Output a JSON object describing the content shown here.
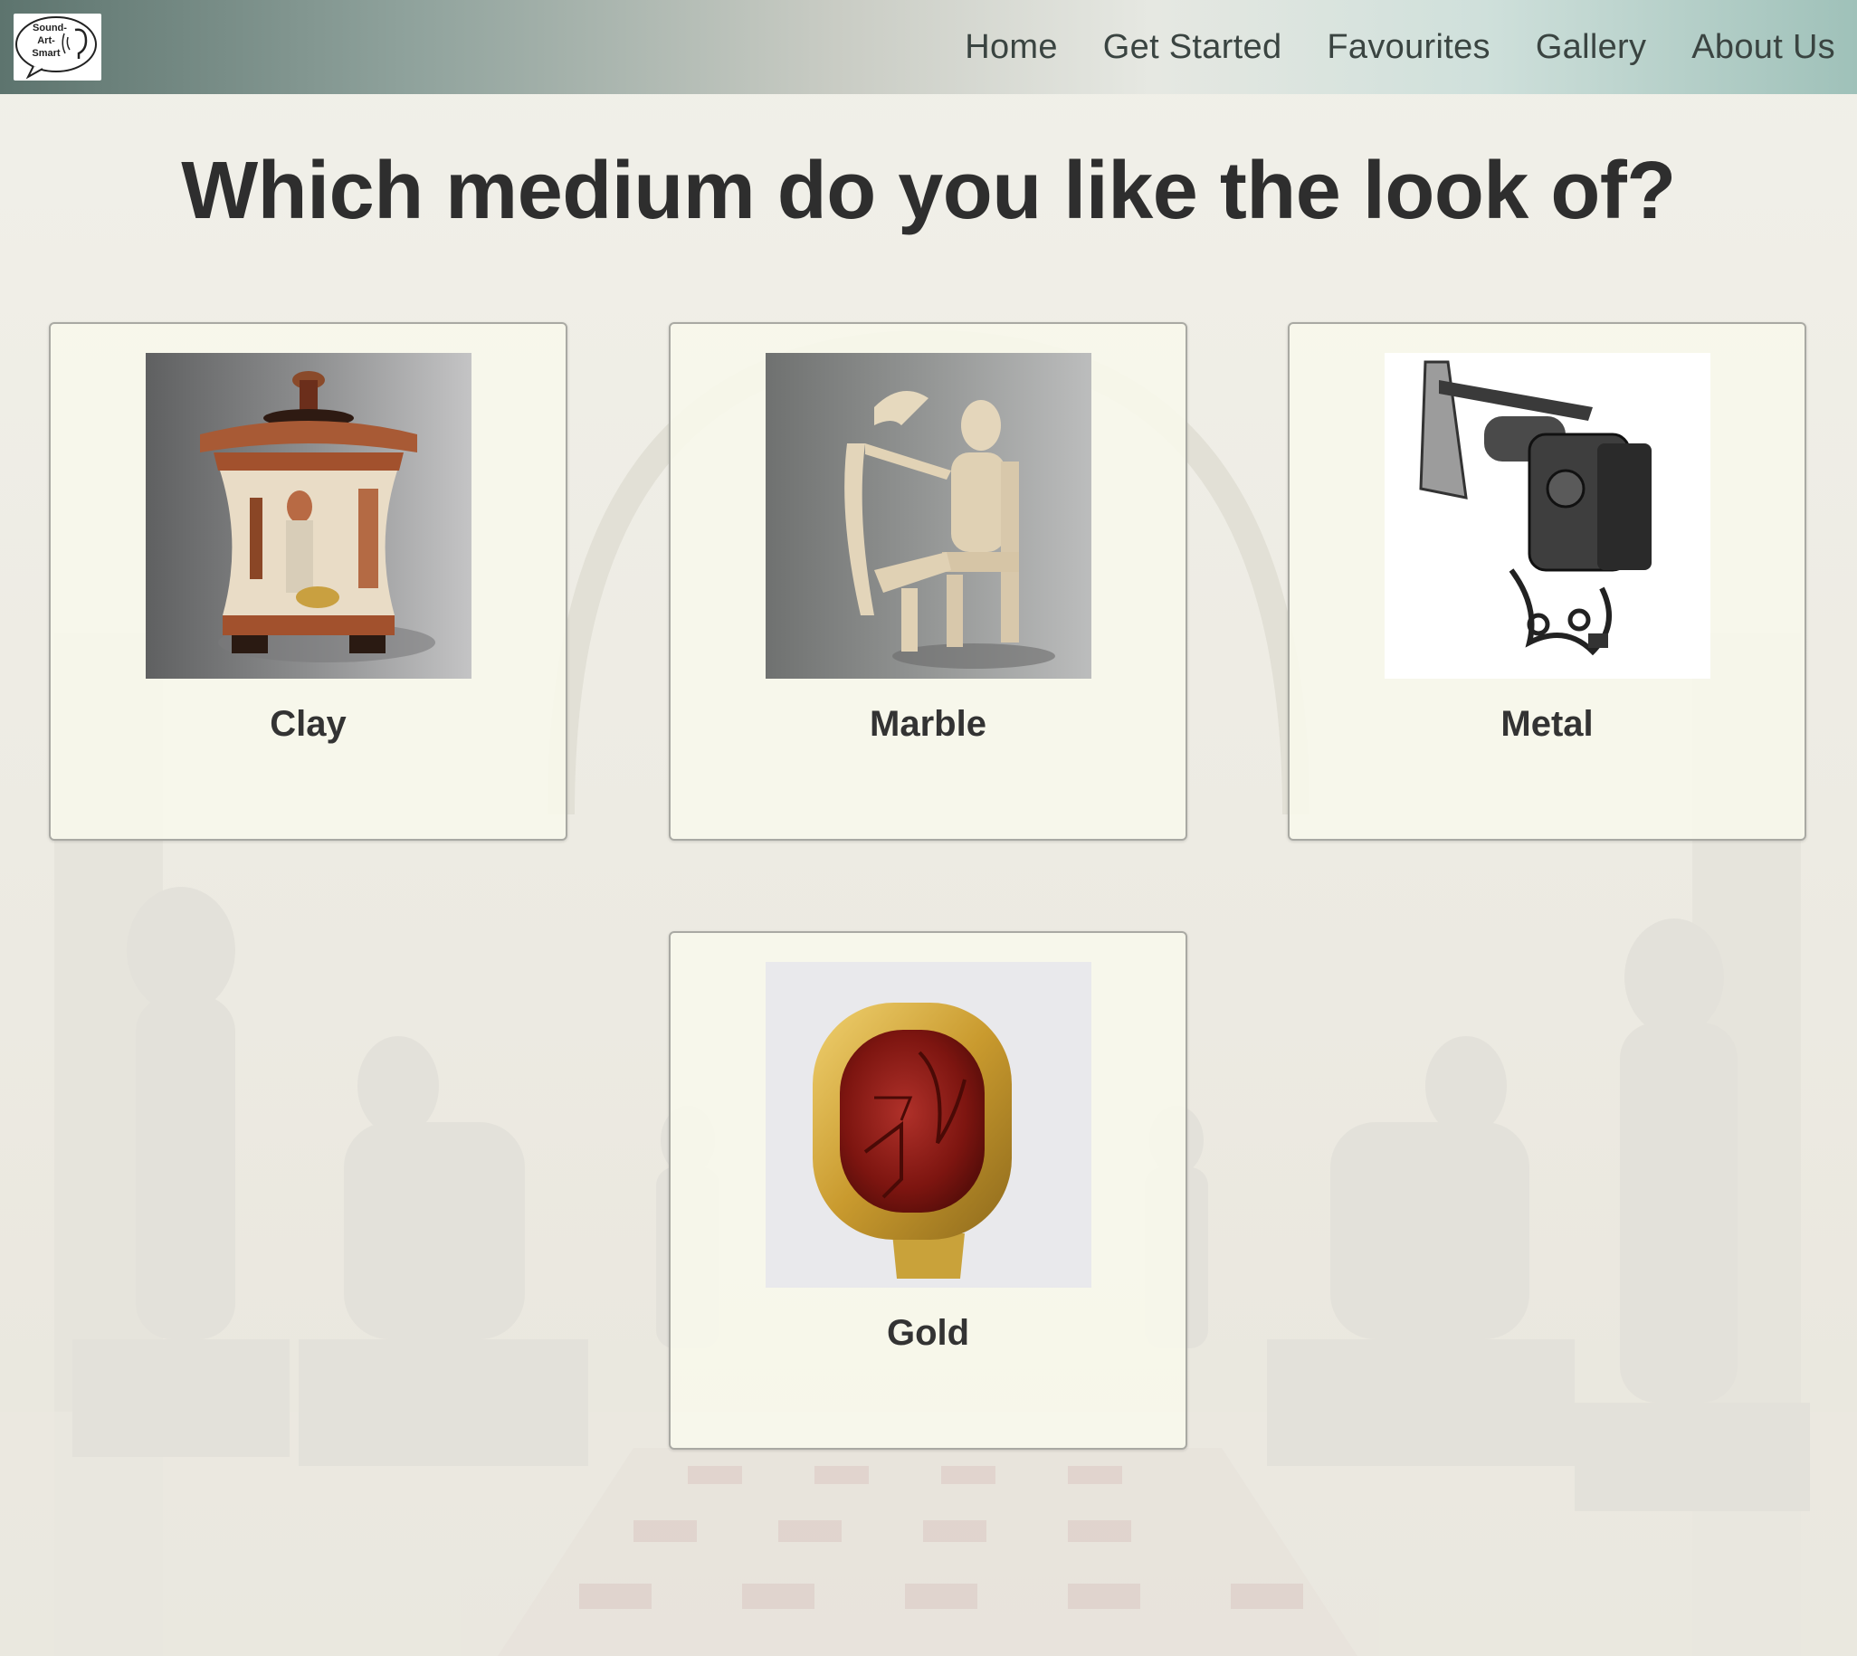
{
  "brand": {
    "logo_text": [
      "Sound-",
      "Art-",
      "Smart"
    ]
  },
  "nav": {
    "items": [
      "Home",
      "Get Started",
      "Favourites",
      "Gallery",
      "About Us"
    ]
  },
  "page": {
    "title": "Which medium do you like the look of?"
  },
  "options": [
    {
      "label": "Clay",
      "image": "greek-pottery-pyxis"
    },
    {
      "label": "Marble",
      "image": "cycladic-harp-player"
    },
    {
      "label": "Metal",
      "image": "metal-sculpture"
    },
    {
      "label": "Gold",
      "image": "gold-ring-red-gem"
    }
  ]
}
